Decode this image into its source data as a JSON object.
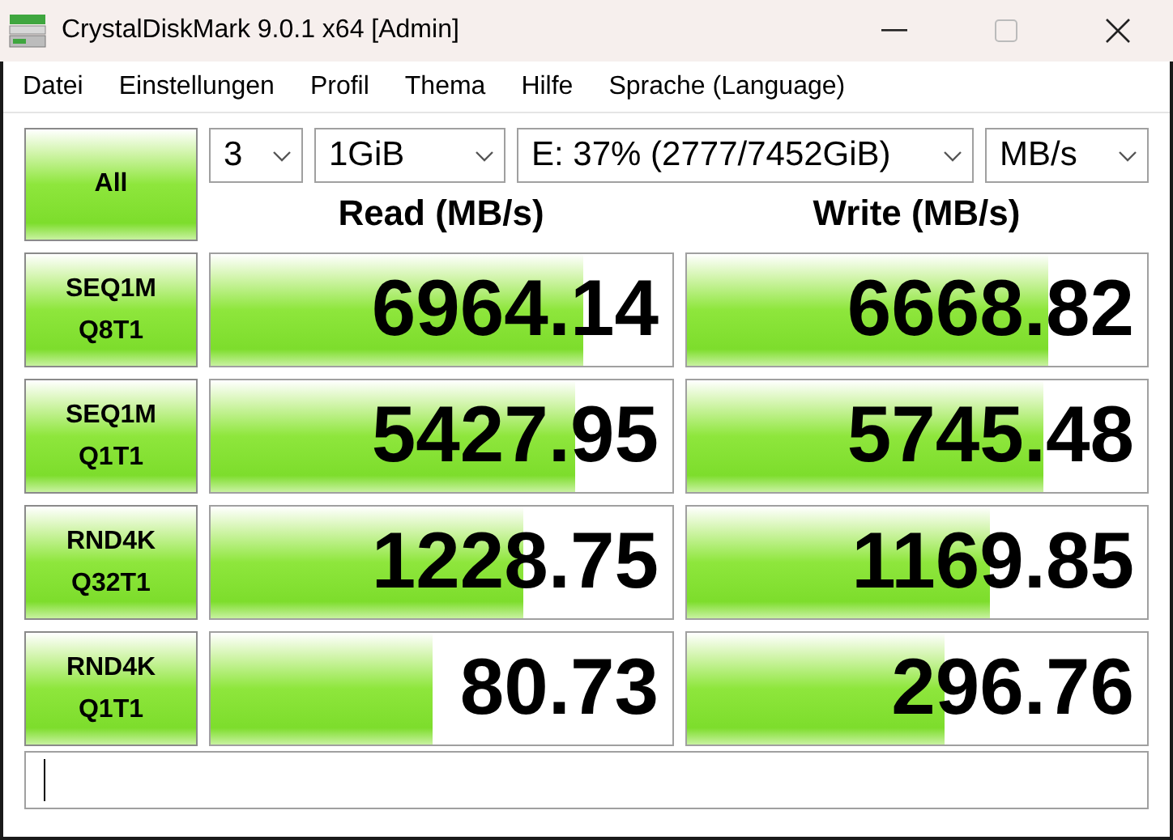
{
  "window": {
    "title": "CrystalDiskMark 9.0.1 x64 [Admin]"
  },
  "menu": [
    "Datei",
    "Einstellungen",
    "Profil",
    "Thema",
    "Hilfe",
    "Sprache (Language)"
  ],
  "all_button": "All",
  "selectors": [
    {
      "value": "3"
    },
    {
      "value": "1GiB"
    },
    {
      "value": "E: 37% (2777/7452GiB)"
    },
    {
      "value": "MB/s"
    }
  ],
  "columns": [
    "Read (MB/s)",
    "Write (MB/s)"
  ],
  "rows": [
    {
      "test": "SEQ1M",
      "params": "Q8T1",
      "read": {
        "value": "6964.14",
        "level": 0.81
      },
      "write": {
        "value": "6668.82",
        "level": 0.785
      }
    },
    {
      "test": "SEQ1M",
      "params": "Q1T1",
      "read": {
        "value": "5427.95",
        "level": 0.79
      },
      "write": {
        "value": "5745.48",
        "level": 0.775
      }
    },
    {
      "test": "RND4K",
      "params": "Q32T1",
      "read": {
        "value": "1228.75",
        "level": 0.68
      },
      "write": {
        "value": "1169.85",
        "level": 0.66
      }
    },
    {
      "test": "RND4K",
      "params": "Q1T1",
      "read": {
        "value": "80.73",
        "level": 0.48
      },
      "write": {
        "value": "296.76",
        "level": 0.56
      }
    }
  ]
}
